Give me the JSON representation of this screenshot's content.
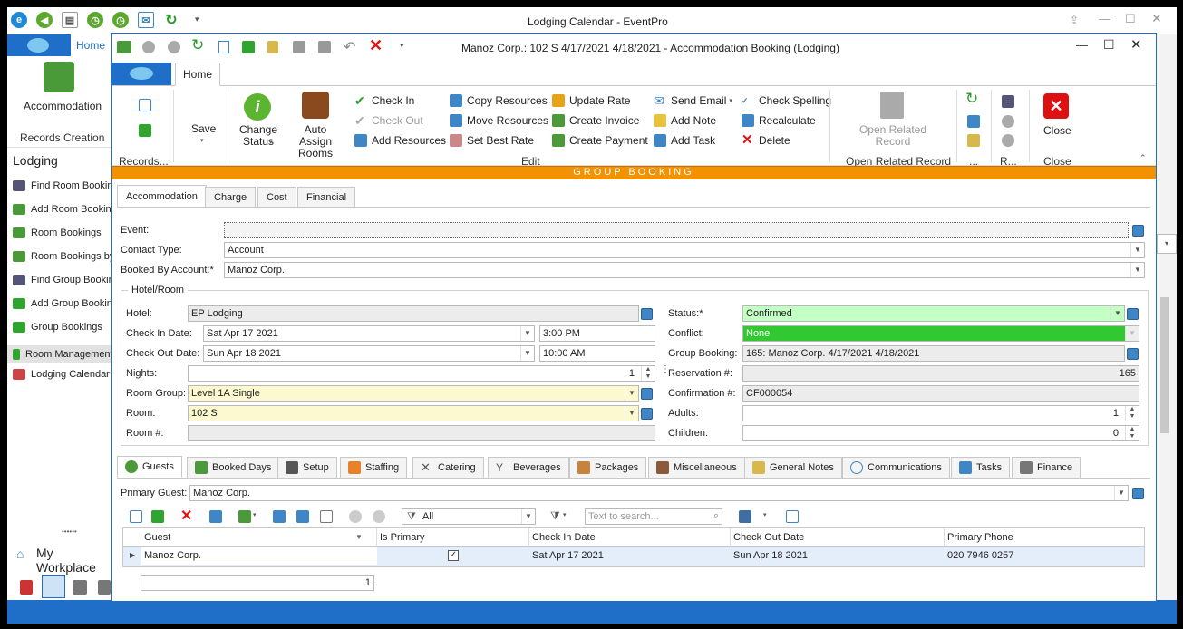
{
  "outer_window": {
    "title": "Lodging Calendar - EventPro",
    "tab_home": "Home",
    "left_panel": {
      "accommodation_label": "Accommodation",
      "records_creation_label": "Records Creation",
      "section_title": "Lodging",
      "items": [
        {
          "label": "Find Room Booking"
        },
        {
          "label": "Add Room Booking"
        },
        {
          "label": "Room Bookings"
        },
        {
          "label": "Room Bookings by"
        },
        {
          "label": "Find Group Booking"
        },
        {
          "label": "Add Group Booking"
        },
        {
          "label": "Group Bookings"
        },
        {
          "label": "Room Management"
        },
        {
          "label": "Lodging Calendar"
        }
      ],
      "dots": "••••••",
      "workplace_label": "My Workplace"
    }
  },
  "inner_window": {
    "title": "Manoz Corp.: 102 S 4/17/2021 4/18/2021  - Accommodation Booking (Lodging)",
    "tab_home": "Home",
    "ribbon": {
      "records_group_label": "Records...",
      "save_label": "Save",
      "change_status_label": "Change Status",
      "auto_assign_rooms_label": "Auto Assign Rooms",
      "check_in_label": "Check In",
      "check_out_label": "Check Out",
      "add_resources_label": "Add Resources",
      "copy_resources_label": "Copy Resources",
      "move_resources_label": "Move Resources",
      "set_best_rate_label": "Set Best Rate",
      "update_rate_label": "Update Rate",
      "create_invoice_label": "Create Invoice",
      "create_payment_label": "Create Payment",
      "send_email_label": "Send Email",
      "add_note_label": "Add Note",
      "add_task_label": "Add Task",
      "check_spelling_label": "Check Spelling",
      "recalculate_label": "Recalculate",
      "delete_label": "Delete",
      "edit_group_label": "Edit",
      "open_related_record_label": "Open Related Record",
      "open_related_record_group_label": "Open Related Record",
      "more_group_label": "...",
      "r_group_label": "R...",
      "close_label": "Close",
      "close_group_label": "Close"
    },
    "banner": "GROUP BOOKING",
    "detail_tabs": [
      "Accommodation",
      "Charge",
      "Cost",
      "Financial"
    ],
    "form": {
      "event_label": "Event:",
      "event_value": "",
      "contact_type_label": "Contact Type:",
      "contact_type_value": "Account",
      "booked_by_label": "Booked By Account:*",
      "booked_by_value": "Manoz Corp.",
      "hotel_room_group": "Hotel/Room",
      "hotel_label": "Hotel:",
      "hotel_value": "EP Lodging",
      "check_in_date_label": "Check In Date:",
      "check_in_date_value": "Sat Apr 17 2021",
      "check_in_time_value": "3:00 PM",
      "check_out_date_label": "Check Out Date:",
      "check_out_date_value": "Sun Apr 18 2021",
      "check_out_time_value": "10:00 AM",
      "nights_label": "Nights:",
      "nights_value": "1",
      "room_group_label": "Room Group:",
      "room_group_value": "Level 1A Single",
      "room_label": "Room:",
      "room_value": "102 S",
      "room_number_label": "Room #:",
      "room_number_value": "",
      "status_label": "Status:*",
      "status_value": "Confirmed",
      "conflict_label": "Conflict:",
      "conflict_value": "None",
      "group_booking_label": "Group Booking:",
      "group_booking_value": "165: Manoz Corp. 4/17/2021 4/18/2021",
      "reservation_label": "Reservation #:",
      "reservation_value": "165",
      "confirmation_label": "Confirmation #:",
      "confirmation_value": "CF000054",
      "adults_label": "Adults:",
      "adults_value": "1",
      "children_label": "Children:",
      "children_value": "0"
    },
    "bottom_tabs": [
      "Guests",
      "Booked Days",
      "Setup",
      "Staffing",
      "Catering",
      "Beverages",
      "Packages",
      "Miscellaneous",
      "General Notes",
      "Communications",
      "Tasks",
      "Finance"
    ],
    "guests": {
      "primary_guest_label": "Primary Guest:",
      "primary_guest_value": "Manoz Corp.",
      "filter_value": "All",
      "search_placeholder": "Text to search...",
      "columns": [
        "Guest",
        "Is Primary",
        "Check In Date",
        "Check Out Date",
        "Primary Phone"
      ],
      "rows": [
        {
          "guest": "Manoz Corp.",
          "is_primary": true,
          "check_in": "Sat Apr 17 2021",
          "check_out": "Sun Apr 18 2021",
          "phone": "020 7946 0257"
        }
      ],
      "footer_count": "1"
    }
  },
  "colors": {
    "accent_blue": "#1f6ec7",
    "banner_orange": "#f39200",
    "status_green": "#c4ffc4",
    "conflict_green": "#32c832",
    "required_yellow": "#fcf8cf"
  }
}
